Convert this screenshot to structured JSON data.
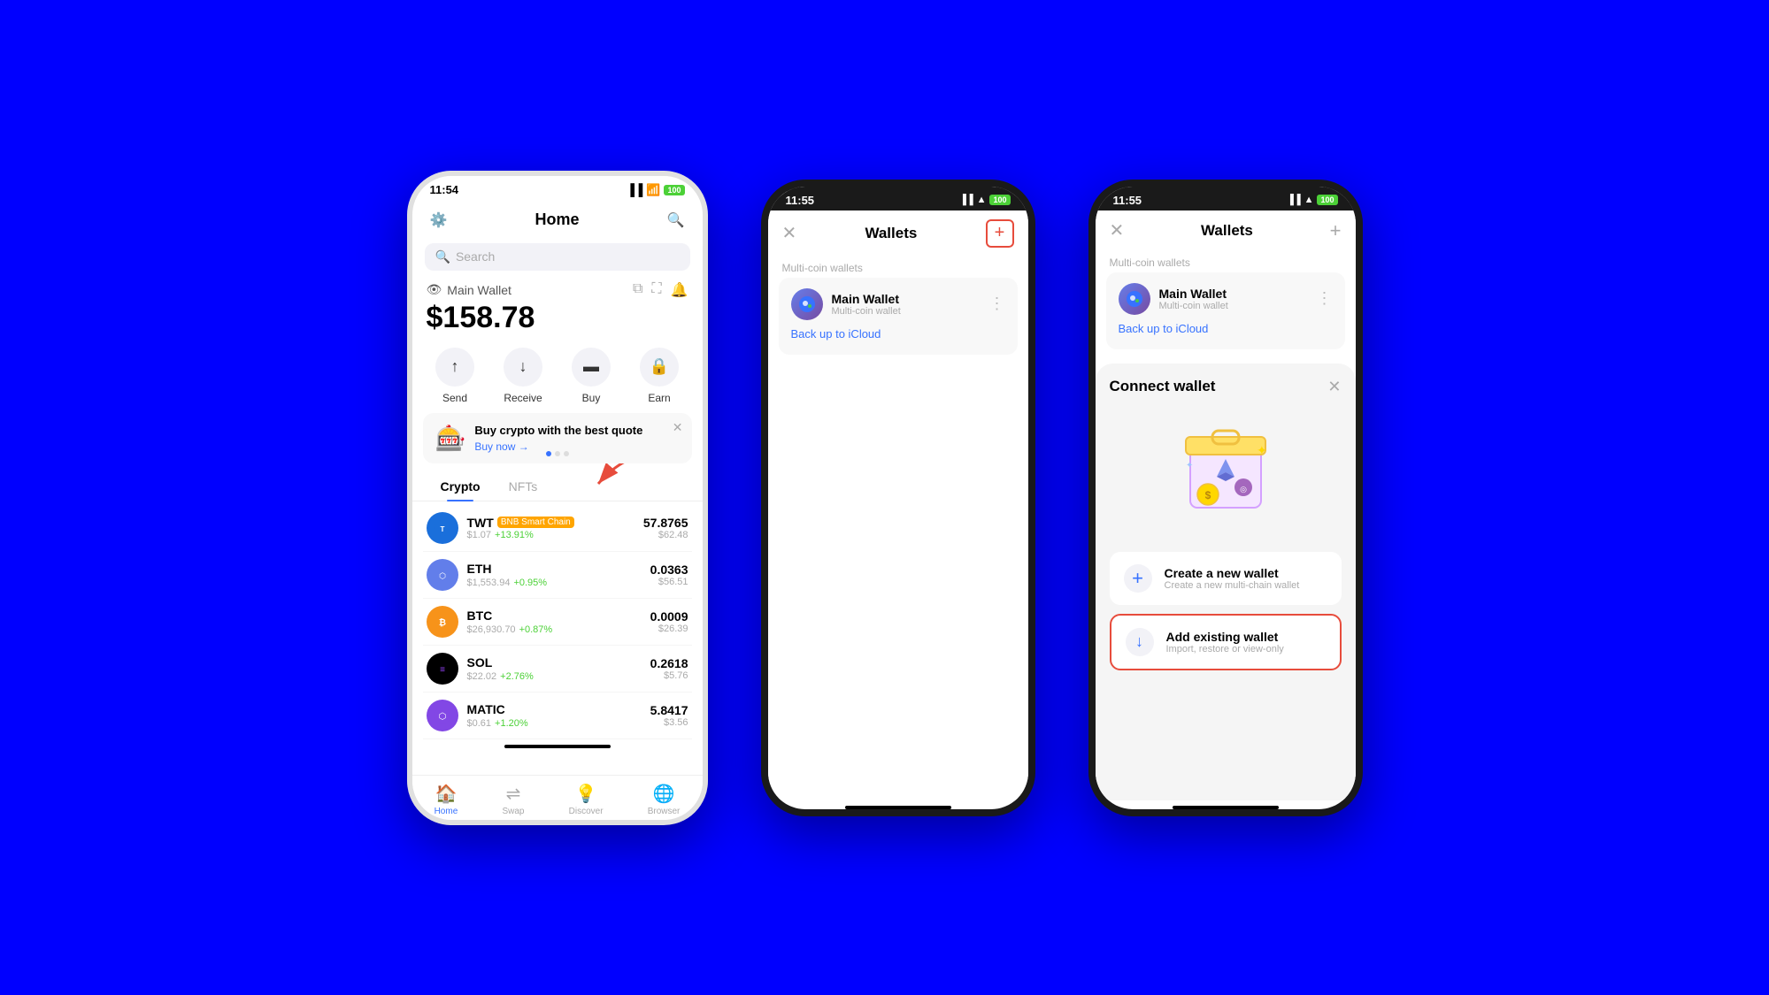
{
  "phone1": {
    "status_time": "11:54",
    "battery": "100",
    "title": "Home",
    "search_placeholder": "Search",
    "wallet_label": "Main Wallet",
    "balance": "$158.78",
    "actions": [
      {
        "label": "Send",
        "icon": "↑"
      },
      {
        "label": "Receive",
        "icon": "↓"
      },
      {
        "label": "Buy",
        "icon": "▬"
      },
      {
        "label": "Earn",
        "icon": "🔒"
      }
    ],
    "promo_title": "Buy crypto with the best quote",
    "promo_link": "Buy now →",
    "tabs": [
      "Crypto",
      "NFTs"
    ],
    "crypto": [
      {
        "name": "TWT",
        "chain": "BNB Smart Chain",
        "price": "$1.07",
        "change": "+13.91%",
        "amount": "57.8765",
        "usd": "$62.48",
        "color": "#1a6fdb"
      },
      {
        "name": "ETH",
        "chain": "",
        "price": "$1,553.94",
        "change": "+0.95%",
        "amount": "0.0363",
        "usd": "$56.51",
        "color": "#627eea"
      },
      {
        "name": "BTC",
        "chain": "",
        "price": "$26,930.70",
        "change": "+0.87%",
        "amount": "0.0009",
        "usd": "$26.39",
        "color": "#f7931a"
      },
      {
        "name": "SOL",
        "chain": "",
        "price": "$22.02",
        "change": "+2.76%",
        "amount": "0.2618",
        "usd": "$5.76",
        "color": "#9945ff"
      },
      {
        "name": "MATIC",
        "chain": "",
        "price": "$0.61",
        "change": "+1.20%",
        "amount": "5.8417",
        "usd": "$3.56",
        "color": "#8247e5"
      }
    ],
    "nav": [
      {
        "label": "Home",
        "active": true
      },
      {
        "label": "Swap",
        "active": false
      },
      {
        "label": "Discover",
        "active": false
      },
      {
        "label": "Browser",
        "active": false
      }
    ]
  },
  "phone2": {
    "status_time": "11:55",
    "battery": "100",
    "title": "Wallets",
    "plus_label": "+",
    "section_label": "Multi-coin wallets",
    "wallet_name": "Main Wallet",
    "wallet_sub": "Multi-coin wallet",
    "backup_link": "Back up to iCloud",
    "close_icon": "×"
  },
  "phone3": {
    "status_time": "11:55",
    "battery": "100",
    "title": "Wallets",
    "plus_label": "+",
    "section_label": "Multi-coin wallets",
    "wallet_name": "Main Wallet",
    "wallet_sub": "Multi-coin wallet",
    "backup_link": "Back up to iCloud",
    "close_icon": "×",
    "connect_title": "Connect wallet",
    "options": [
      {
        "label": "Create a new wallet",
        "sub": "Create a new multi-chain wallet",
        "icon": "+"
      },
      {
        "label": "Add existing wallet",
        "sub": "Import, restore or view-only",
        "icon": "↓"
      }
    ]
  }
}
